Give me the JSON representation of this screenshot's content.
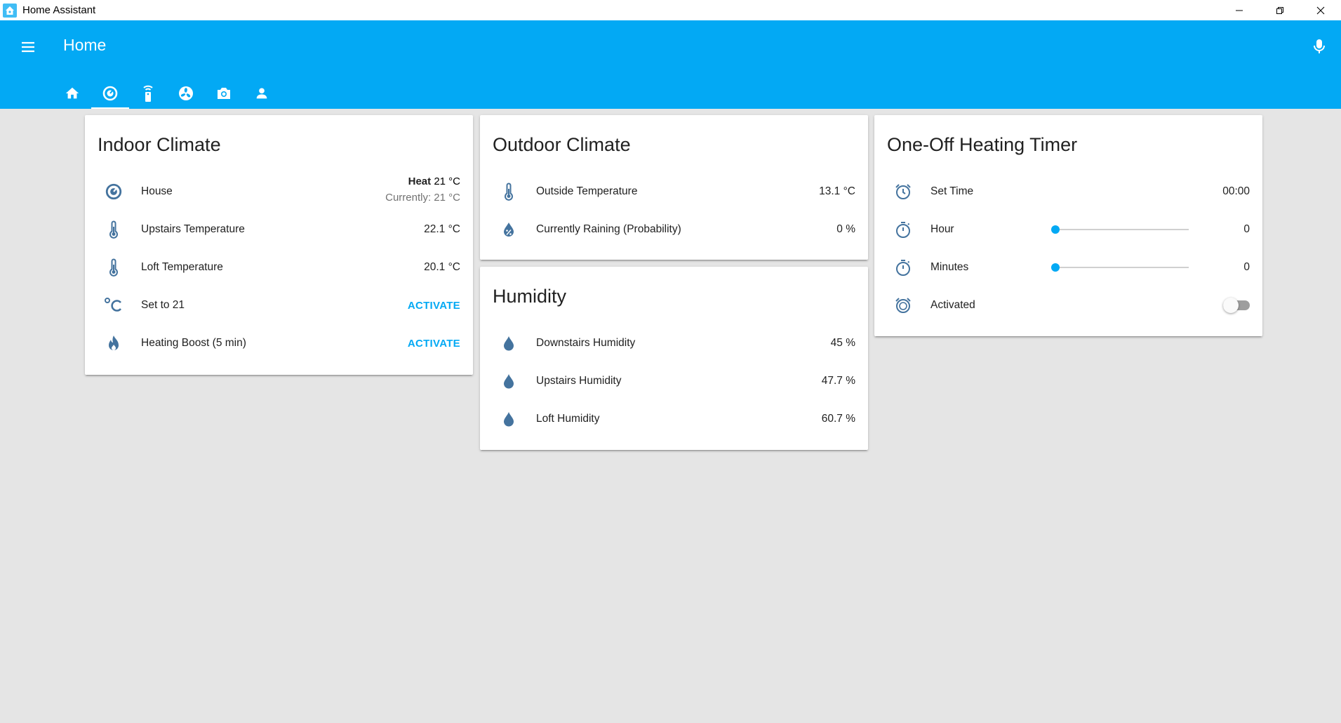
{
  "window": {
    "title": "Home Assistant"
  },
  "header": {
    "title": "Home"
  },
  "tabs": [
    {
      "icon": "home-icon"
    },
    {
      "icon": "thermostat-icon",
      "active": true
    },
    {
      "icon": "remote-icon"
    },
    {
      "icon": "fan-icon"
    },
    {
      "icon": "camera-icon"
    },
    {
      "icon": "person-icon"
    }
  ],
  "indoor": {
    "title": "Indoor Climate",
    "house": {
      "label": "House",
      "mode": "Heat",
      "target": "21 °C",
      "current": "Currently: 21 °C"
    },
    "upstairs": {
      "label": "Upstairs Temperature",
      "value": "22.1 °C"
    },
    "loft": {
      "label": "Loft Temperature",
      "value": "20.1 °C"
    },
    "set21": {
      "label": "Set to 21",
      "action": "ACTIVATE"
    },
    "boost": {
      "label": "Heating Boost (5 min)",
      "action": "ACTIVATE"
    }
  },
  "outdoor": {
    "title": "Outdoor Climate",
    "temp": {
      "label": "Outside Temperature",
      "value": "13.1 °C"
    },
    "rain": {
      "label": "Currently Raining (Probability)",
      "value": "0 %"
    }
  },
  "humidity": {
    "title": "Humidity",
    "downstairs": {
      "label": "Downstairs Humidity",
      "value": "45 %"
    },
    "upstairs": {
      "label": "Upstairs Humidity",
      "value": "47.7 %"
    },
    "loft": {
      "label": "Loft Humidity",
      "value": "60.7 %"
    }
  },
  "timer": {
    "title": "One-Off Heating Timer",
    "set_time": {
      "label": "Set Time",
      "value": "00:00"
    },
    "hour": {
      "label": "Hour",
      "value": "0",
      "level": 0
    },
    "minutes": {
      "label": "Minutes",
      "value": "0",
      "level": 0
    },
    "activated": {
      "label": "Activated",
      "on": false
    }
  },
  "colors": {
    "primary": "#03a9f4",
    "icon": "#44739e",
    "background": "#e5e5e5"
  }
}
